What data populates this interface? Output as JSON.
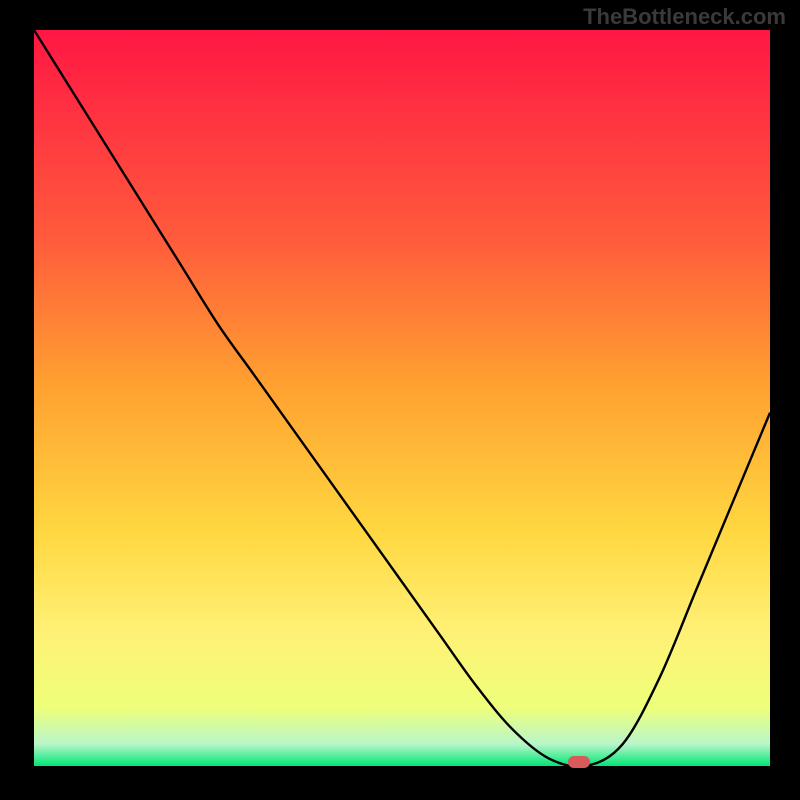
{
  "watermark": "TheBottleneck.com",
  "chart_data": {
    "type": "line",
    "title": "",
    "xlabel": "",
    "ylabel": "",
    "xlim": [
      0,
      100
    ],
    "ylim": [
      0,
      100
    ],
    "x": [
      0,
      5,
      10,
      15,
      20,
      25,
      30,
      35,
      40,
      45,
      50,
      55,
      60,
      65,
      70,
      75,
      80,
      85,
      90,
      95,
      100
    ],
    "values": [
      100,
      92,
      84,
      76,
      68,
      60,
      53,
      46,
      39,
      32,
      25,
      18,
      11,
      5,
      1,
      0,
      3,
      12,
      24,
      36,
      48
    ],
    "marker": {
      "x": 74,
      "y": 0
    },
    "gradient_colors": {
      "top": "#ff1744",
      "upper_mid": "#ff7043",
      "mid": "#ffd740",
      "lower_mid": "#ffee58",
      "low": "#eeff41",
      "bottom": "#00e676"
    }
  }
}
